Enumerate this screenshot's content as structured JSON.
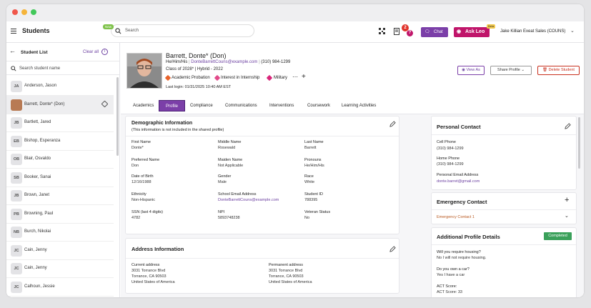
{
  "colors": {
    "accent": "#7b3fa8",
    "leo": "#c0156a",
    "danger": "#c8301e",
    "success": "#3aa05a",
    "link": "#6b3fa0"
  },
  "app": {
    "title": "Students",
    "new_badge": "New",
    "search_placeholder": "Search",
    "notification_count": "2",
    "chat_label": "Chat",
    "ask_leo_label": "Ask Leo",
    "leo_badge": "Beta",
    "user": "Jake Killian  Exeat Sales (COUNS)"
  },
  "sidebar": {
    "title": "Student List",
    "clear_all": "Clear all",
    "search_placeholder": "Search student name",
    "students": [
      {
        "initials": "JA",
        "name": "Anderson, Jason"
      },
      {
        "initials": "",
        "name": "Barrett, Donte* (Don)"
      },
      {
        "initials": "JB",
        "name": "Bartlett, Jared"
      },
      {
        "initials": "EB",
        "name": "Bishop, Esperanza"
      },
      {
        "initials": "OB",
        "name": "Blair, Osvaldo"
      },
      {
        "initials": "SB",
        "name": "Booker, Sanai"
      },
      {
        "initials": "JB",
        "name": "Brown, Janet"
      },
      {
        "initials": "PB",
        "name": "Browning, Paul"
      },
      {
        "initials": "NB",
        "name": "Burch, Nikolai"
      },
      {
        "initials": "JC",
        "name": "Cain, Jenny"
      },
      {
        "initials": "JC",
        "name": "Cain, Jenny"
      },
      {
        "initials": "JC",
        "name": "Calhoun, Jessie"
      }
    ]
  },
  "profile": {
    "name": "Barrett, Donte*  (Don)",
    "pronouns": "He/Him/His",
    "email": "DonteBarrettCouns@example.com",
    "phone": "(310) 984-1299",
    "class_info": "Class of 2028*  |  Hybrid - 2022",
    "tags": [
      "Academic Probation",
      "Interest in Internship",
      "Military"
    ],
    "last_login": "Last login: 01/31/2025 10:40 AM EST",
    "view_as": "View As",
    "share_profile": "Share Profile",
    "delete_student": "Delete Student"
  },
  "tabs": [
    "Academics",
    "Profile",
    "Compliance",
    "Communications",
    "Interventions",
    "Coursework",
    "Learning Activities"
  ],
  "demographic": {
    "title": "Demographic Information",
    "subtitle": "(This information is not included in the shared profile)",
    "fields": [
      {
        "label": "First Name",
        "value": "Donte*"
      },
      {
        "label": "Middle Name",
        "value": "Rosewald"
      },
      {
        "label": "Last Name",
        "value": "Barrett"
      },
      {
        "label": "Preferred Name",
        "value": "Don"
      },
      {
        "label": "Maiden Name",
        "value": "Not Applicable"
      },
      {
        "label": "Pronouns",
        "value": "He/Him/His"
      },
      {
        "label": "Date of Birth",
        "value": "12/16/1988"
      },
      {
        "label": "Gender",
        "value": "Male"
      },
      {
        "label": "Race",
        "value": "White"
      },
      {
        "label": "Ethnicity",
        "value": "Non-Hispanic"
      },
      {
        "label": "School Email Address",
        "value": "DonteBarrettCouns@example.com"
      },
      {
        "label": "Student ID",
        "value": "788395"
      },
      {
        "label": "SSN (last 4 digits)",
        "value": "4782"
      },
      {
        "label": "NPI",
        "value": "5893748238"
      },
      {
        "label": "Veteran Status",
        "value": "No"
      }
    ]
  },
  "address": {
    "title": "Address Information",
    "current": {
      "label": "Current address",
      "line1": "3031 Torrance Blvd",
      "line2": "Torrance, CA 90503",
      "line3": "United States of America"
    },
    "permanent": {
      "label": "Permanent address",
      "line1": "3031 Torrance Blvd",
      "line2": "Torrance, CA 90503",
      "line3": "United States of America"
    }
  },
  "personal_contact": {
    "title": "Personal Contact",
    "cell_label": "Cell Phone",
    "cell": "(310) 984-1299",
    "home_label": "Home Phone",
    "home": "(310) 984-1299",
    "email_label": "Personal Email Address",
    "email": "donte.barret@gmail.com"
  },
  "emergency": {
    "title": "Emergency Contact",
    "contact": "Emergency Contact 1"
  },
  "additional": {
    "title": "Additional Profile Details",
    "status": "Completed",
    "items": [
      {
        "q": "Will you require housing?",
        "a": "No I will not require housing."
      },
      {
        "q": "Do you own a car?",
        "a": "Yes I have a car"
      },
      {
        "q": "ACT Score:",
        "a": "ACT Score: 33"
      }
    ]
  }
}
